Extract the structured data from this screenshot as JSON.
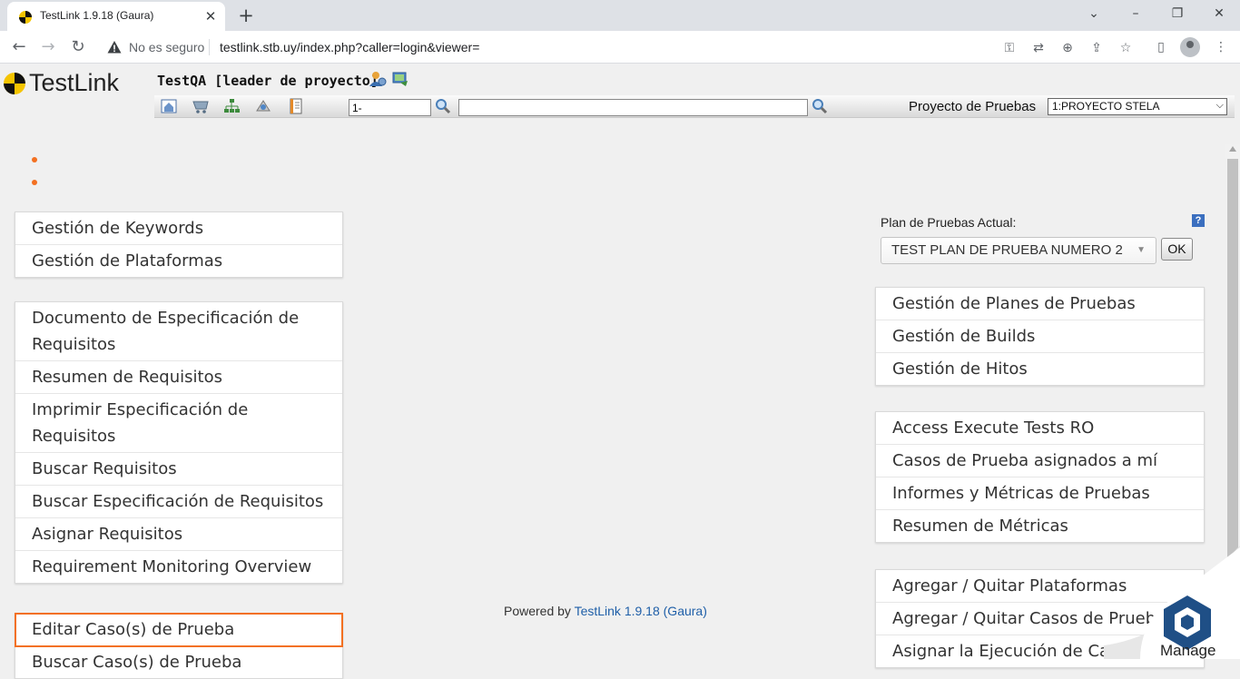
{
  "browser": {
    "tab_title": "TestLink 1.9.18 (Gaura)",
    "tab_close": "✕",
    "new_tab": "+",
    "window_controls": {
      "minimize": "⌄",
      "restore": "–",
      "maximize": "❐",
      "close": "✕"
    },
    "nav": {
      "back": "←",
      "forward": "→",
      "reload": "↻"
    },
    "security_label": "No es seguro",
    "url": "testlink.stb.uy/index.php?caller=login&viewer=",
    "omnibox_icons": [
      "key-icon",
      "translate-icon",
      "zoom-icon",
      "share-icon",
      "star-icon"
    ],
    "toolbar_icons": [
      "side-panel-icon",
      "profile-icon",
      "menu-icon"
    ]
  },
  "header": {
    "logo_text": "TestLink",
    "user_info": "TestQA [leader de proyecto]",
    "tc_id_value": "1-",
    "search_value": "",
    "project_label": "Proyecto de Pruebas",
    "project_selected": "1:PROYECTO STELA"
  },
  "left_groups": [
    {
      "items": [
        "Gestión de Keywords",
        "Gestión de Plataformas"
      ]
    },
    {
      "items": [
        "Documento de Especificación de Requisitos",
        "Resumen de Requisitos",
        "Imprimir Especificación de Requisitos",
        "Buscar Requisitos",
        "Buscar Especificación de Requisitos",
        "Asignar Requisitos",
        "Requirement Monitoring Overview"
      ]
    },
    {
      "items": [
        "Editar Caso(s) de Prueba",
        "Buscar Caso(s) de Prueba"
      ]
    }
  ],
  "plan": {
    "label": "Plan de Pruebas Actual:",
    "help": "?",
    "selected": "TEST PLAN DE PRUEBA NUMERO 2",
    "ok_label": "OK"
  },
  "right_groups": [
    {
      "items": [
        "Gestión de Planes de Pruebas",
        "Gestión de Builds",
        "Gestión de Hitos"
      ]
    },
    {
      "items": [
        "Access Execute Tests RO",
        "Casos de Prueba asignados a mí",
        "Informes y Métricas de Pruebas",
        "Resumen de Métricas"
      ]
    },
    {
      "items": [
        "Agregar / Quitar Plataformas",
        "Agregar / Quitar Casos de Prueba",
        "Asignar la Ejecución de Casos de Prueba"
      ]
    }
  ],
  "footer": {
    "prefix": "Powered by",
    "link": "TestLink 1.9.18 (Gaura)"
  },
  "manage_badge": {
    "label": "Manage"
  },
  "colors": {
    "accent": "#f37021",
    "link": "#1f5fa8",
    "page_bg": "#f0f0f0"
  }
}
